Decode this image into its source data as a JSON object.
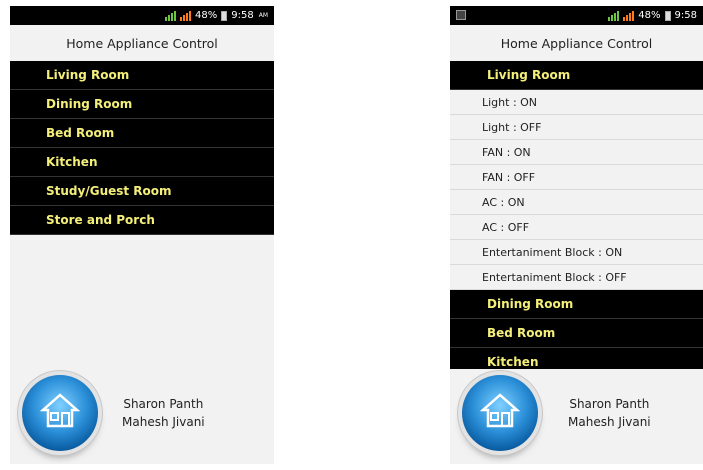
{
  "status": {
    "battery": "48%",
    "time": "9:58",
    "ampm": "AM"
  },
  "header": {
    "title": "Home Appliance Control"
  },
  "left": {
    "rooms": [
      "Living Room",
      "Dining Room",
      "Bed Room",
      "Kitchen",
      "Study/Guest Room",
      "Store and Porch"
    ]
  },
  "right": {
    "expanded_room": "Living Room",
    "actions": [
      "Light : ON",
      "Light : OFF",
      "FAN : ON",
      "FAN : OFF",
      "AC : ON",
      "AC : OFF",
      "Entertaniment Block : ON",
      "Entertaniment Block : OFF"
    ],
    "rooms_after": [
      "Dining Room",
      "Bed Room",
      "Kitchen"
    ]
  },
  "footer": {
    "names": [
      "Sharon Panth",
      "Mahesh Jivani"
    ]
  },
  "colors": {
    "room_bar": "#000000",
    "room_text": "#f4ef7a",
    "background": "#f2f2f2"
  },
  "icons": {
    "app": "house-icon"
  }
}
